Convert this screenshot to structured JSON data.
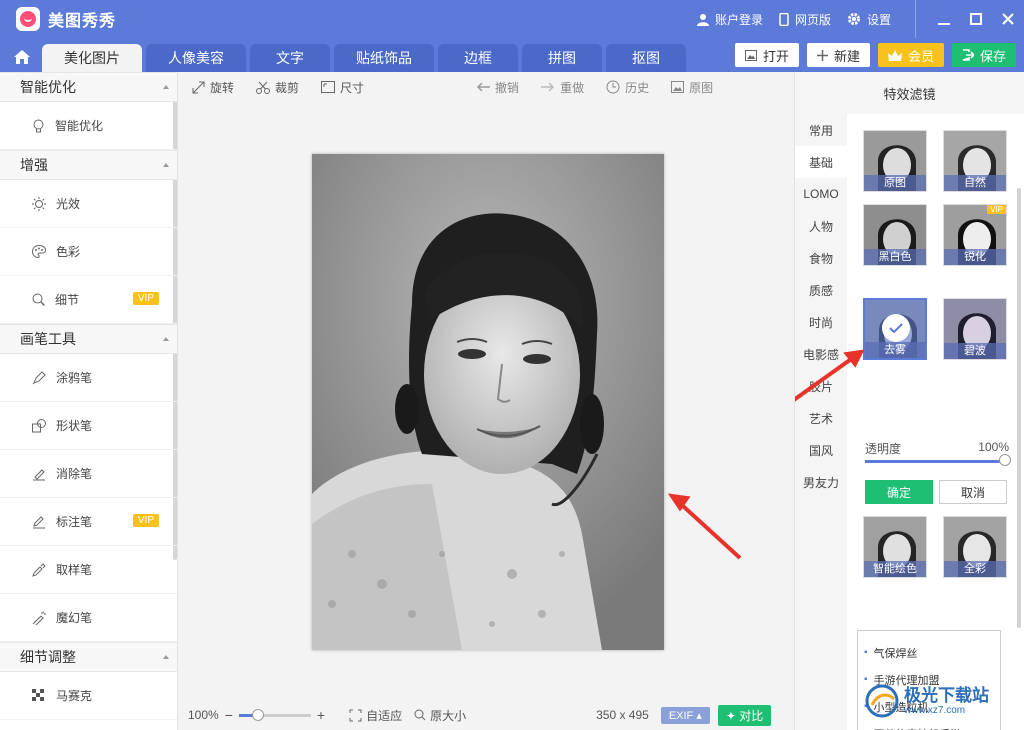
{
  "app": {
    "title": "美图秀秀"
  },
  "titlebar": {
    "login": "账户登录",
    "web": "网页版",
    "settings": "设置"
  },
  "tabs": [
    {
      "label": "美化图片"
    },
    {
      "label": "人像美容"
    },
    {
      "label": "文字"
    },
    {
      "label": "贴纸饰品"
    },
    {
      "label": "边框"
    },
    {
      "label": "拼图"
    },
    {
      "label": "抠图"
    }
  ],
  "actions": {
    "open": "打开",
    "new": "新建",
    "vip": "会员",
    "save": "保存"
  },
  "sidebar": {
    "sections": [
      {
        "title": "智能优化",
        "items": [
          {
            "label": "智能优化",
            "icon": "bulb-icon"
          }
        ]
      },
      {
        "title": "增强",
        "items": [
          {
            "label": "光效",
            "icon": "sun-icon"
          },
          {
            "label": "色彩",
            "icon": "palette-icon"
          },
          {
            "label": "细节",
            "icon": "magnifier-icon",
            "badge": "VIP"
          }
        ]
      },
      {
        "title": "画笔工具",
        "items": [
          {
            "label": "涂鸦笔",
            "icon": "doodle-pen-icon"
          },
          {
            "label": "形状笔",
            "icon": "shape-pen-icon"
          },
          {
            "label": "消除笔",
            "icon": "eraser-pen-icon"
          },
          {
            "label": "标注笔",
            "icon": "mark-pen-icon",
            "badge": "VIP"
          },
          {
            "label": "取样笔",
            "icon": "eyedropper-icon"
          },
          {
            "label": "魔幻笔",
            "icon": "magic-wand-icon"
          }
        ]
      },
      {
        "title": "细节调整",
        "items": [
          {
            "label": "马赛克",
            "icon": "mosaic-icon"
          }
        ]
      }
    ]
  },
  "toolbar": {
    "rotate": "旋转",
    "crop": "裁剪",
    "size": "尺寸",
    "undo": "撤销",
    "redo": "重做",
    "history": "历史",
    "original": "原图"
  },
  "bottombar": {
    "zoom": "100%",
    "fit": "自适应",
    "actual": "原大小",
    "dimensions": "350 x 495",
    "exif": "EXIF",
    "compare": "对比",
    "zoom_fraction": 0.25
  },
  "rpanel": {
    "title": "特效滤镜",
    "categories": [
      "常用",
      "基础",
      "LOMO",
      "人物",
      "食物",
      "质感",
      "时尚",
      "电影感",
      "胶片",
      "艺术",
      "国风",
      "男友力"
    ],
    "active_category": "基础",
    "filters": [
      {
        "label": "原图"
      },
      {
        "label": "自然"
      },
      {
        "label": "黑白色"
      },
      {
        "label": "锐化",
        "badge": "VIP"
      },
      {
        "label": "去雾",
        "selected": true
      },
      {
        "label": "碧波"
      },
      {
        "label": "智能绘色"
      },
      {
        "label": "全彩"
      }
    ],
    "opacity_label": "透明度",
    "opacity_value": "100%",
    "confirm": "确定",
    "cancel": "取消",
    "ads": [
      "气保焊丝",
      "手游代理加盟",
      "小型造粒机",
      "至尊传奇挂机手游"
    ]
  },
  "watermark": {
    "text": "极光下载站",
    "url": "www.xz7.com"
  },
  "colors": {
    "brand": "#5c7bd9",
    "green": "#1fbf73",
    "vip": "#f9c21b"
  }
}
